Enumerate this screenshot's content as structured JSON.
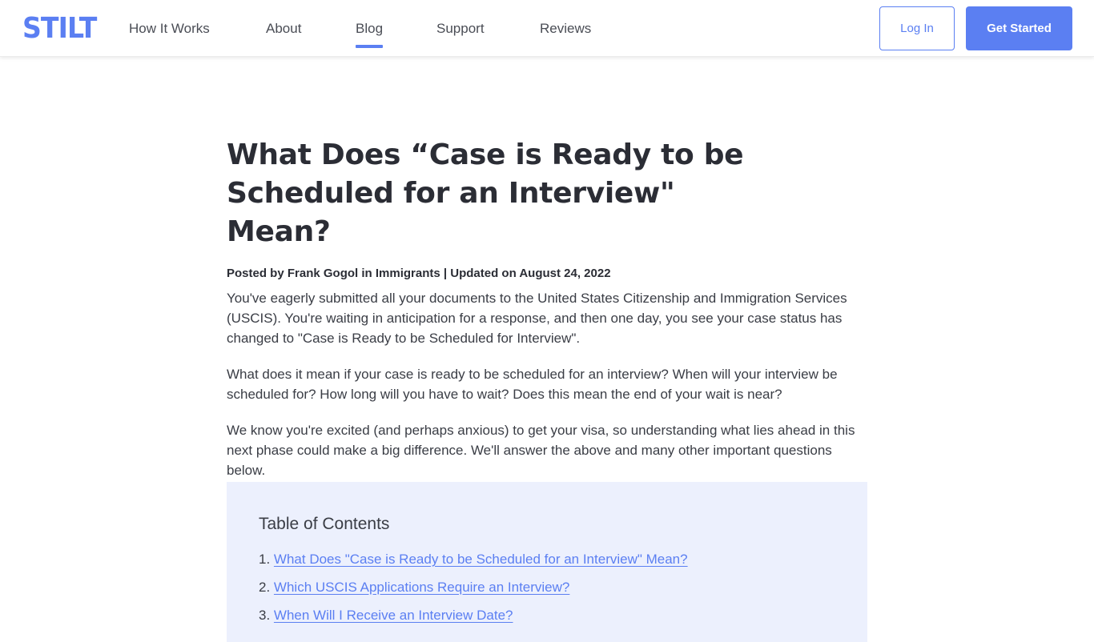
{
  "header": {
    "logo": "STILT",
    "nav": [
      {
        "label": "How It Works",
        "active": false
      },
      {
        "label": "About",
        "active": false
      },
      {
        "label": "Blog",
        "active": true
      },
      {
        "label": "Support",
        "active": false
      },
      {
        "label": "Reviews",
        "active": false
      }
    ],
    "login_label": "Log In",
    "get_started_label": "Get Started"
  },
  "article": {
    "title": "What Does “Case is Ready to be Scheduled for an Interview\" Mean?",
    "meta": "Posted by Frank Gogol in Immigrants | Updated on August 24, 2022",
    "paragraphs": [
      "You've eagerly submitted all your documents to the United States Citizenship and Immigration Services (USCIS). You're waiting in anticipation for a response, and then one day, you see your case status has changed to \"Case is Ready to be Scheduled for Interview\".",
      "What does it mean if your case is ready to be scheduled for an interview? When will your interview be scheduled for? How long will you have to wait? Does this mean the end of your wait is near?",
      "We know you're excited (and perhaps anxious) to get your visa, so understanding what lies ahead in this next phase could make a big difference. We'll answer the above and many other important questions below."
    ]
  },
  "toc": {
    "title": "Table of Contents",
    "items": [
      {
        "num": "1.",
        "label": "What Does \"Case is Ready to be Scheduled for an Interview\" Mean?"
      },
      {
        "num": "2.",
        "label": "Which USCIS Applications Require an Interview?"
      },
      {
        "num": "3.",
        "label": "When Will I Receive an Interview Date?"
      }
    ]
  },
  "colors": {
    "accent": "#5b7ff2",
    "toc_background": "#ecf0fd",
    "text": "#2b2d35"
  }
}
